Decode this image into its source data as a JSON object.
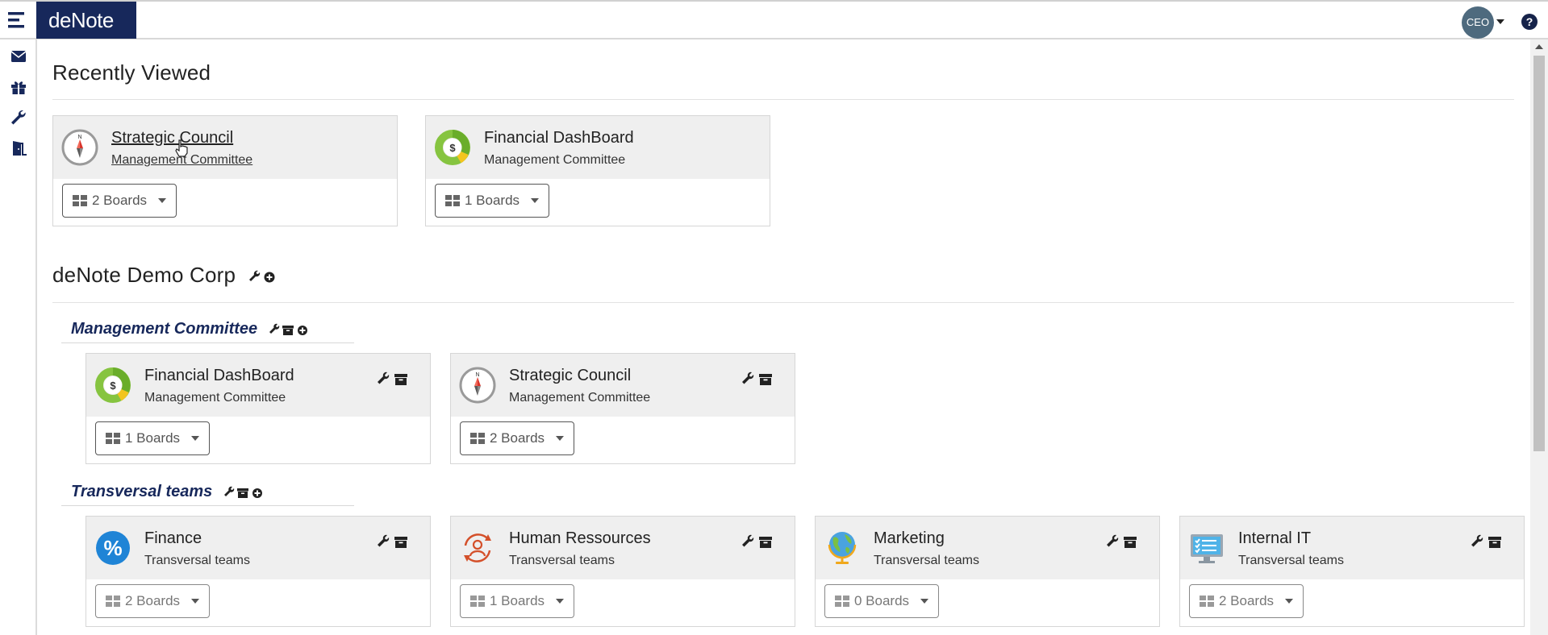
{
  "app": {
    "logo": "deNote",
    "user_initials": "CEO",
    "help_label": "?"
  },
  "recent": {
    "heading": "Recently Viewed",
    "cards": [
      {
        "title": "Strategic Council",
        "subtitle": "Management Committee",
        "boards": "2 Boards",
        "icon": "compass-icon"
      },
      {
        "title": "Financial DashBoard",
        "subtitle": "Management Committee",
        "boards": "1 Boards",
        "icon": "dollar-donut-icon"
      }
    ]
  },
  "org": {
    "name": "deNote Demo Corp",
    "groups": [
      {
        "name": "Management Committee",
        "cards": [
          {
            "title": "Financial DashBoard",
            "subtitle": "Management Committee",
            "boards": "1 Boards",
            "icon": "dollar-donut-icon"
          },
          {
            "title": "Strategic Council",
            "subtitle": "Management Committee",
            "boards": "2 Boards",
            "icon": "compass-icon"
          }
        ]
      },
      {
        "name": "Transversal teams",
        "cards": [
          {
            "title": "Finance",
            "subtitle": "Transversal teams",
            "boards": "2 Boards",
            "icon": "percent-icon"
          },
          {
            "title": "Human Ressources",
            "subtitle": "Transversal teams",
            "boards": "1 Boards",
            "icon": "person-cycle-icon"
          },
          {
            "title": "Marketing",
            "subtitle": "Transversal teams",
            "boards": "0 Boards",
            "icon": "globe-icon"
          },
          {
            "title": "Internal IT",
            "subtitle": "Transversal teams",
            "boards": "2 Boards",
            "icon": "monitor-checklist-icon"
          }
        ]
      }
    ]
  },
  "colors": {
    "brand": "#17285b",
    "card_header": "#efefef",
    "group_title": "#17285b",
    "avatar": "#4e6a7e"
  }
}
